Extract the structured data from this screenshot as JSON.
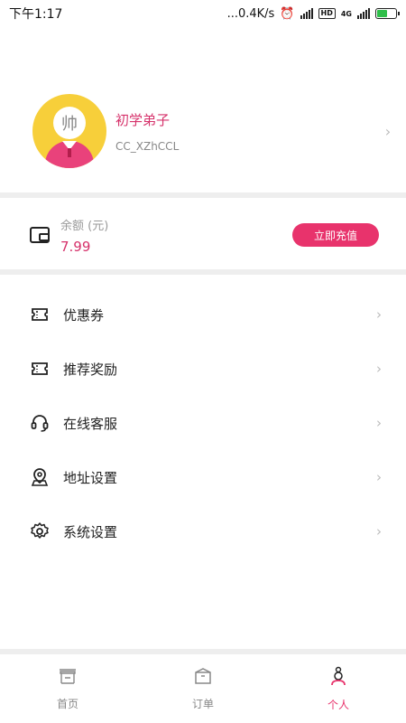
{
  "status_bar": {
    "time": "下午1:17",
    "network_speed": "...0.4K/s",
    "hd_badge": "HD",
    "net_type": "4G",
    "battery_level": 0.6
  },
  "profile": {
    "avatar_char": "帅",
    "nickname": "初学弟子",
    "username": "CC_XZhCCL"
  },
  "balance": {
    "label": "余额 (元)",
    "value": "7.99",
    "recharge_button": "立即充值"
  },
  "menu": {
    "items": [
      {
        "label": "优惠券",
        "icon": "coupon-icon"
      },
      {
        "label": "推荐奖励",
        "icon": "ticket-icon"
      },
      {
        "label": "在线客服",
        "icon": "headset-icon"
      },
      {
        "label": "地址设置",
        "icon": "map-pin-icon"
      },
      {
        "label": "系统设置",
        "icon": "gear-icon"
      }
    ]
  },
  "tabs": [
    {
      "label": "首页",
      "icon": "home-icon",
      "active": false
    },
    {
      "label": "订单",
      "icon": "box-icon",
      "active": false
    },
    {
      "label": "个人",
      "icon": "user-icon",
      "active": true
    }
  ],
  "colors": {
    "accent": "#e8336c",
    "avatar_bg": "#f7cf3a",
    "divider": "#eeeeee"
  }
}
